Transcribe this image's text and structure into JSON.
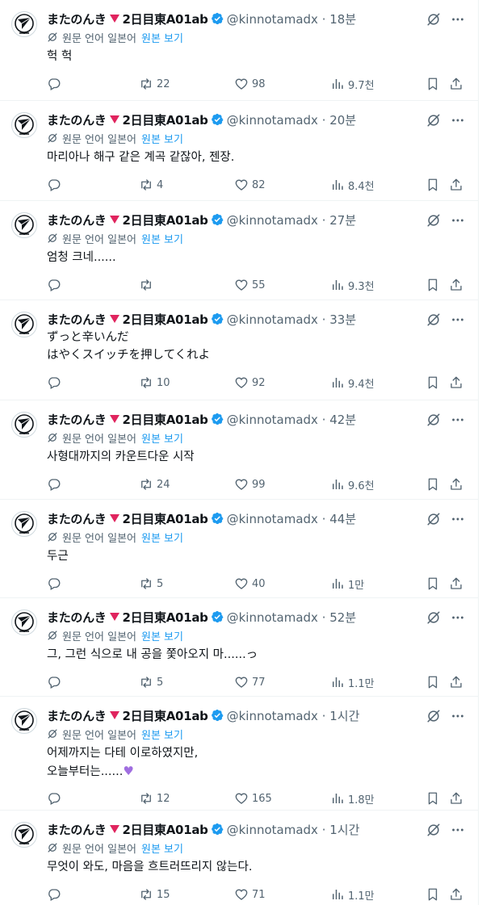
{
  "tweets": [
    {
      "name": "またのんき",
      "name2": "2日目東A01ab",
      "handle": "@kinnotamadx · 18분",
      "translate_label": "원문 언어 일본어",
      "translate_link": "원본 보기",
      "text_lines": [
        "헉 헉"
      ],
      "replies": "",
      "retweets": "22",
      "likes": "98",
      "views": "9.7천"
    },
    {
      "name": "またのんき",
      "name2": "2日目東A01ab",
      "handle": "@kinnotamadx · 20분",
      "translate_label": "원문 언어 일본어",
      "translate_link": "원본 보기",
      "text_lines": [
        "마리아나 해구 같은 계곡 같잖아, 젠장."
      ],
      "replies": "",
      "retweets": "4",
      "likes": "82",
      "views": "8.4천"
    },
    {
      "name": "またのんき",
      "name2": "2日目東A01ab",
      "handle": "@kinnotamadx · 27분",
      "translate_label": "원문 언어 일본어",
      "translate_link": "원본 보기",
      "text_lines": [
        "엄청 크네......"
      ],
      "replies": "",
      "retweets": "",
      "likes": "55",
      "views": "9.3천"
    },
    {
      "name": "またのんき",
      "name2": "2日目東A01ab",
      "handle": "@kinnotamadx · 33분",
      "translate_label": "",
      "translate_link": "",
      "text_lines": [
        "ずっと辛いんだ",
        "はやくスイッチを押してくれよ"
      ],
      "replies": "",
      "retweets": "10",
      "likes": "92",
      "views": "9.4천"
    },
    {
      "name": "またのんき",
      "name2": "2日目東A01ab",
      "handle": "@kinnotamadx · 42분",
      "translate_label": "원문 언어 일본어",
      "translate_link": "원본 보기",
      "text_lines": [
        "사형대까지의 카운트다운 시작"
      ],
      "replies": "",
      "retweets": "24",
      "likes": "99",
      "views": "9.6천"
    },
    {
      "name": "またのんき",
      "name2": "2日目東A01ab",
      "handle": "@kinnotamadx · 44분",
      "translate_label": "원문 언어 일본어",
      "translate_link": "원본 보기",
      "text_lines": [
        "두근"
      ],
      "replies": "",
      "retweets": "5",
      "likes": "40",
      "views": "1만"
    },
    {
      "name": "またのんき",
      "name2": "2日目東A01ab",
      "handle": "@kinnotamadx · 52분",
      "translate_label": "원문 언어 일본어",
      "translate_link": "원본 보기",
      "text_lines": [
        "그, 그런 식으로 내 공을 쫓아오지 마......っ"
      ],
      "replies": "",
      "retweets": "5",
      "likes": "77",
      "views": "1.1만"
    },
    {
      "name": "またのんき",
      "name2": "2日目東A01ab",
      "handle": "@kinnotamadx · 1시간",
      "translate_label": "원문 언어 일본어",
      "translate_link": "원본 보기",
      "text_lines": [
        "어제까지는 다테 이로하였지만,",
        "오늘부터는......"
      ],
      "replies": "",
      "retweets": "12",
      "likes": "165",
      "views": "1.8만"
    },
    {
      "name": "またのんき",
      "name2": "2日目東A01ab",
      "handle": "@kinnotamadx · 1시간",
      "translate_label": "원문 언어 일본어",
      "translate_link": "원본 보기",
      "text_lines": [
        "무엇이 와도, 마음을 흐트러뜨리지 않는다."
      ],
      "replies": "",
      "retweets": "15",
      "likes": "71",
      "views": "1.1만"
    }
  ],
  "icons": {
    "accent": "#1d9bf0",
    "muted": "#536471",
    "name_mark": "#e0245e",
    "emoji": "purple-heart"
  }
}
